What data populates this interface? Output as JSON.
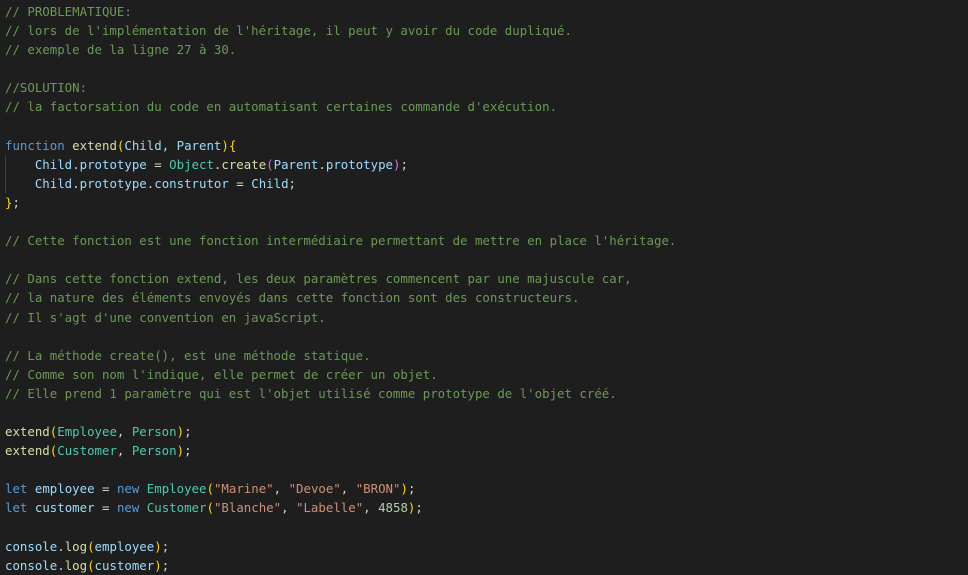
{
  "colors": {
    "background": "#1e1e1e",
    "comment": "#6a9955",
    "keyword": "#569cd6",
    "function": "#dcdcaa",
    "variable": "#9cdcfe",
    "class": "#4ec9b0",
    "string": "#ce9178",
    "number": "#b5cea8",
    "default": "#d4d4d4",
    "bracket_level1": "#ffd700",
    "bracket_level2": "#da70d6",
    "bracket_level3": "#179fff"
  },
  "lines": [
    [
      {
        "t": "comment",
        "v": "// PROBLEMATIQUE:"
      }
    ],
    [
      {
        "t": "comment",
        "v": "// lors de l'implémentation de l'héritage, il peut y avoir du code dupliqué."
      }
    ],
    [
      {
        "t": "comment",
        "v": "// exemple de la ligne 27 à 30."
      }
    ],
    [],
    [
      {
        "t": "comment",
        "v": "//SOLUTION:"
      }
    ],
    [
      {
        "t": "comment",
        "v": "// la factorsation du code en automatisant certaines commande d'exécution."
      }
    ],
    [],
    [
      {
        "t": "keyword",
        "v": "function"
      },
      {
        "t": "punct",
        "v": " "
      },
      {
        "t": "func",
        "v": "extend"
      },
      {
        "t": "bracket1",
        "v": "("
      },
      {
        "t": "param",
        "v": "Child"
      },
      {
        "t": "punct",
        "v": ", "
      },
      {
        "t": "param",
        "v": "Parent"
      },
      {
        "t": "bracket1",
        "v": ")"
      },
      {
        "t": "bracket1",
        "v": "{"
      }
    ],
    [
      {
        "t": "indent",
        "v": "    "
      },
      {
        "t": "param",
        "v": "Child"
      },
      {
        "t": "punct",
        "v": "."
      },
      {
        "t": "prop",
        "v": "prototype"
      },
      {
        "t": "punct",
        "v": " = "
      },
      {
        "t": "class",
        "v": "Object"
      },
      {
        "t": "punct",
        "v": "."
      },
      {
        "t": "func",
        "v": "create"
      },
      {
        "t": "bracket2",
        "v": "("
      },
      {
        "t": "param",
        "v": "Parent"
      },
      {
        "t": "punct",
        "v": "."
      },
      {
        "t": "prop",
        "v": "prototype"
      },
      {
        "t": "bracket2",
        "v": ")"
      },
      {
        "t": "punct",
        "v": ";"
      }
    ],
    [
      {
        "t": "indent",
        "v": "    "
      },
      {
        "t": "param",
        "v": "Child"
      },
      {
        "t": "punct",
        "v": "."
      },
      {
        "t": "prop",
        "v": "prototype"
      },
      {
        "t": "punct",
        "v": "."
      },
      {
        "t": "prop",
        "v": "construtor"
      },
      {
        "t": "punct",
        "v": " = "
      },
      {
        "t": "param",
        "v": "Child"
      },
      {
        "t": "punct",
        "v": ";"
      }
    ],
    [
      {
        "t": "bracket1",
        "v": "}"
      },
      {
        "t": "punct",
        "v": ";"
      }
    ],
    [],
    [
      {
        "t": "comment",
        "v": "// Cette fonction est une fonction intermédiaire permettant de mettre en place l'héritage."
      }
    ],
    [],
    [
      {
        "t": "comment",
        "v": "// Dans cette fonction extend, les deux paramètres commencent par une majuscule car,"
      }
    ],
    [
      {
        "t": "comment",
        "v": "// la nature des éléments envoyés dans cette fonction sont des constructeurs."
      }
    ],
    [
      {
        "t": "comment",
        "v": "// Il s'agt d'une convention en javaScript."
      }
    ],
    [],
    [
      {
        "t": "comment",
        "v": "// La méthode create(), est une méthode statique."
      }
    ],
    [
      {
        "t": "comment",
        "v": "// Comme son nom l'indique, elle permet de créer un objet."
      }
    ],
    [
      {
        "t": "comment",
        "v": "// Elle prend 1 paramètre qui est l'objet utilisé comme prototype de l'objet créé."
      }
    ],
    [],
    [
      {
        "t": "func",
        "v": "extend"
      },
      {
        "t": "bracket1",
        "v": "("
      },
      {
        "t": "class",
        "v": "Employee"
      },
      {
        "t": "punct",
        "v": ", "
      },
      {
        "t": "class",
        "v": "Person"
      },
      {
        "t": "bracket1",
        "v": ")"
      },
      {
        "t": "punct",
        "v": ";"
      }
    ],
    [
      {
        "t": "func",
        "v": "extend"
      },
      {
        "t": "bracket1",
        "v": "("
      },
      {
        "t": "class",
        "v": "Customer"
      },
      {
        "t": "punct",
        "v": ", "
      },
      {
        "t": "class",
        "v": "Person"
      },
      {
        "t": "bracket1",
        "v": ")"
      },
      {
        "t": "punct",
        "v": ";"
      }
    ],
    [],
    [
      {
        "t": "keyword",
        "v": "let"
      },
      {
        "t": "punct",
        "v": " "
      },
      {
        "t": "ident",
        "v": "employee"
      },
      {
        "t": "punct",
        "v": " = "
      },
      {
        "t": "keyword",
        "v": "new"
      },
      {
        "t": "punct",
        "v": " "
      },
      {
        "t": "class",
        "v": "Employee"
      },
      {
        "t": "bracket1",
        "v": "("
      },
      {
        "t": "string",
        "v": "\"Marine\""
      },
      {
        "t": "punct",
        "v": ", "
      },
      {
        "t": "string",
        "v": "\"Devoe\""
      },
      {
        "t": "punct",
        "v": ", "
      },
      {
        "t": "string",
        "v": "\"BRON\""
      },
      {
        "t": "bracket1",
        "v": ")"
      },
      {
        "t": "punct",
        "v": ";"
      }
    ],
    [
      {
        "t": "keyword",
        "v": "let"
      },
      {
        "t": "punct",
        "v": " "
      },
      {
        "t": "ident",
        "v": "customer"
      },
      {
        "t": "punct",
        "v": " = "
      },
      {
        "t": "keyword",
        "v": "new"
      },
      {
        "t": "punct",
        "v": " "
      },
      {
        "t": "class",
        "v": "Customer"
      },
      {
        "t": "bracket1",
        "v": "("
      },
      {
        "t": "string",
        "v": "\"Blanche\""
      },
      {
        "t": "punct",
        "v": ", "
      },
      {
        "t": "string",
        "v": "\"Labelle\""
      },
      {
        "t": "punct",
        "v": ", "
      },
      {
        "t": "number",
        "v": "4858"
      },
      {
        "t": "bracket1",
        "v": ")"
      },
      {
        "t": "punct",
        "v": ";"
      }
    ],
    [],
    [
      {
        "t": "ident",
        "v": "console"
      },
      {
        "t": "punct",
        "v": "."
      },
      {
        "t": "func",
        "v": "log"
      },
      {
        "t": "bracket1",
        "v": "("
      },
      {
        "t": "ident",
        "v": "employee"
      },
      {
        "t": "bracket1",
        "v": ")"
      },
      {
        "t": "punct",
        "v": ";"
      }
    ],
    [
      {
        "t": "ident",
        "v": "console"
      },
      {
        "t": "punct",
        "v": "."
      },
      {
        "t": "func",
        "v": "log"
      },
      {
        "t": "bracket1",
        "v": "("
      },
      {
        "t": "ident",
        "v": "customer"
      },
      {
        "t": "bracket1",
        "v": ")"
      },
      {
        "t": "punct",
        "v": ";"
      }
    ]
  ]
}
